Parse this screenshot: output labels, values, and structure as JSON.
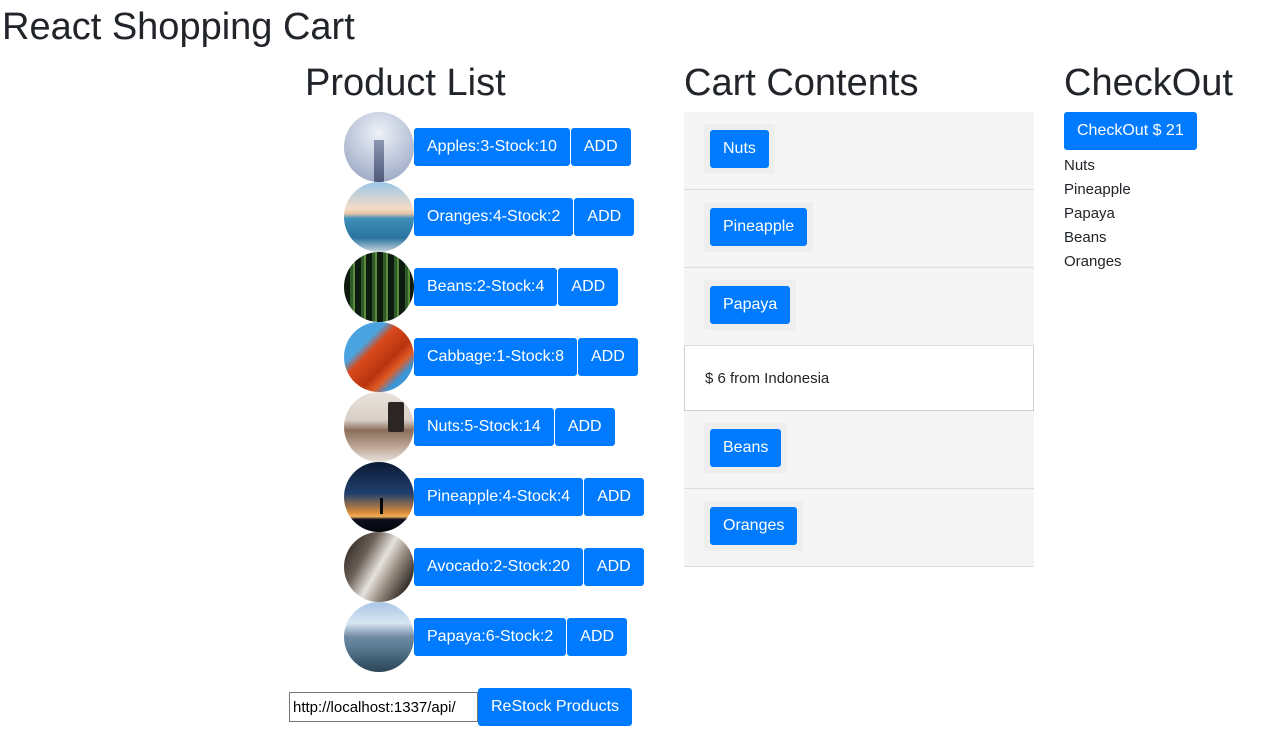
{
  "app": {
    "title": "React Shopping Cart"
  },
  "product_list": {
    "title": "Product List",
    "products": [
      {
        "label": "Apples:3-Stock:10",
        "add_label": "ADD",
        "image": "mist-tower"
      },
      {
        "label": "Oranges:4-Stock:2",
        "add_label": "ADD",
        "image": "ocean-horizon"
      },
      {
        "label": "Beans:2-Stock:4",
        "add_label": "ADD",
        "image": "green-forest"
      },
      {
        "label": "Cabbage:1-Stock:8",
        "add_label": "ADD",
        "image": "red-bridge"
      },
      {
        "label": "Nuts:5-Stock:14",
        "add_label": "ADD",
        "image": "wooden-table"
      },
      {
        "label": "Pineapple:4-Stock:4",
        "add_label": "ADD",
        "image": "sunset-silhouette"
      },
      {
        "label": "Avocado:2-Stock:20",
        "add_label": "ADD",
        "image": "waterfall-rocks"
      },
      {
        "label": "Papaya:6-Stock:2",
        "add_label": "ADD",
        "image": "fjord-mountains"
      }
    ],
    "api_input_value": "http://localhost:1337/api/",
    "restock_label": "ReStock Products"
  },
  "cart": {
    "title": "Cart Contents",
    "items": [
      "Nuts",
      "Pineapple",
      "Papaya",
      "Beans",
      "Oranges"
    ],
    "tooltip": "$ 6 from Indonesia"
  },
  "checkout": {
    "title": "CheckOut",
    "button_label": "CheckOut $ 21",
    "items": [
      "Nuts",
      "Pineapple",
      "Papaya",
      "Beans",
      "Oranges"
    ]
  },
  "colors": {
    "primary": "#007bff",
    "cart_bg": "#f5f5f5",
    "text": "#212529"
  }
}
